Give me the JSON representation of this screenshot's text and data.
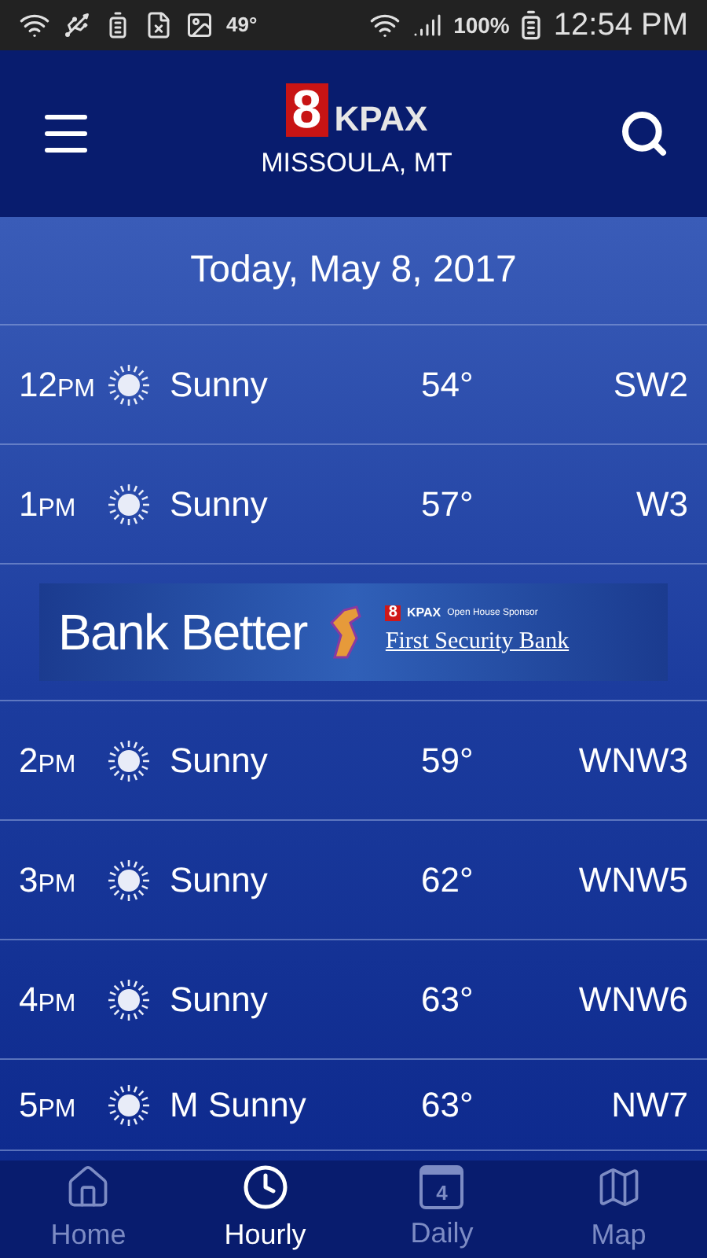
{
  "status_bar": {
    "temperature": "49°",
    "battery": "100%",
    "time": "12:54 PM"
  },
  "header": {
    "logo_number": "8",
    "logo_text": "KPAX",
    "location": "MISSOULA, MT"
  },
  "date": "Today, May 8, 2017",
  "hours": [
    {
      "hour": "12",
      "period": "PM",
      "condition": "Sunny",
      "temp": "54°",
      "wind": "SW2"
    },
    {
      "hour": "1",
      "period": "PM",
      "condition": "Sunny",
      "temp": "57°",
      "wind": "W3"
    },
    {
      "kind": "ad",
      "headline": "Bank Better",
      "sponsor_number": "8",
      "sponsor_logo": "KPAX",
      "sponsor_note": "Open House Sponsor",
      "bank": "First Security Bank"
    },
    {
      "hour": "2",
      "period": "PM",
      "condition": "Sunny",
      "temp": "59°",
      "wind": "WNW3"
    },
    {
      "hour": "3",
      "period": "PM",
      "condition": "Sunny",
      "temp": "62°",
      "wind": "WNW5"
    },
    {
      "hour": "4",
      "period": "PM",
      "condition": "Sunny",
      "temp": "63°",
      "wind": "WNW6"
    },
    {
      "hour": "5",
      "period": "PM",
      "condition": "M Sunny",
      "temp": "63°",
      "wind": "NW7"
    }
  ],
  "nav": [
    {
      "kind": "home",
      "label": "Home",
      "selected": false
    },
    {
      "kind": "clock",
      "label": "Hourly",
      "selected": true
    },
    {
      "kind": "calendar",
      "label": "Daily",
      "day_number": "4",
      "selected": false
    },
    {
      "kind": "map",
      "label": "Map",
      "selected": false
    }
  ]
}
